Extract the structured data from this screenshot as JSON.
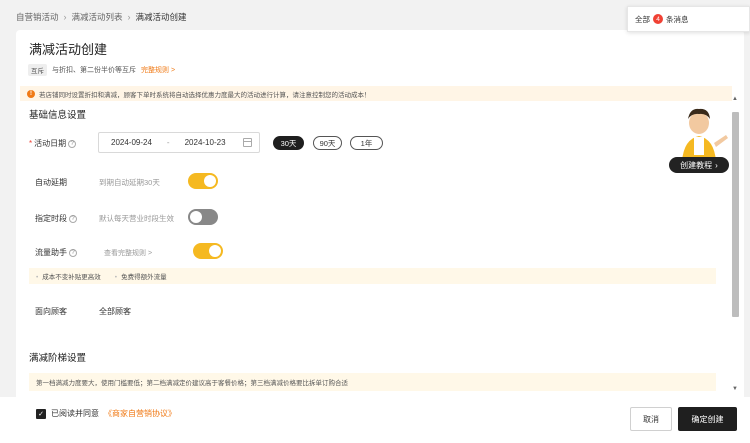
{
  "breadcrumb": [
    "自营销活动",
    "满减活动列表",
    "满减活动创建"
  ],
  "notifications": {
    "prefix": "全部",
    "count": "4",
    "suffix": "条消息"
  },
  "page": {
    "title": "满减活动创建",
    "mutex_tag": "互斥",
    "mutex_text": "与折扣、第二份半价等互斥",
    "full_rules_link": "完整规则 >"
  },
  "warning": "若店铺同时设置折扣和满减，顾客下单时系统将自动选择优惠力度最大的活动进行计算，请注意控制您的活动成本！",
  "basic_info": {
    "section_title": "基础信息设置",
    "activity_date": {
      "label": "活动日期",
      "start": "2024-09-24",
      "end": "2024-10-23",
      "presets": [
        "30天",
        "90天",
        "1年"
      ],
      "active_preset": "30天"
    },
    "auto_extend": {
      "label": "自动延期",
      "hint": "到期自动延期30天",
      "enabled": true
    },
    "time_slot": {
      "label": "指定时段",
      "hint": "默认每天营业时段生效",
      "enabled": false
    },
    "traffic_helper": {
      "label": "流量助手",
      "link": "查看完整规则 >",
      "enabled": true
    },
    "tips": [
      "成本不变补贴更高效",
      "免费得额外流量"
    ],
    "audience": {
      "label": "面向顾客",
      "value": "全部顾客"
    }
  },
  "tier": {
    "section_title": "满减阶梯设置",
    "tip": "第一档满减力度要大，使用门槛要低；第二档满减定价建议高于客餐价格；第三档满减价格要比拆单订购合适"
  },
  "tutorial_button": "创建教程",
  "footer": {
    "agree_prefix": "已阅读并同意",
    "agreement_link": "《商家自营销协议》",
    "cancel": "取消",
    "confirm": "确定创建"
  },
  "colors": {
    "accent_yellow": "#f5b921",
    "link_orange": "#f07a16",
    "primary_dark": "#1f1f1f",
    "badge_red": "#f04134"
  }
}
